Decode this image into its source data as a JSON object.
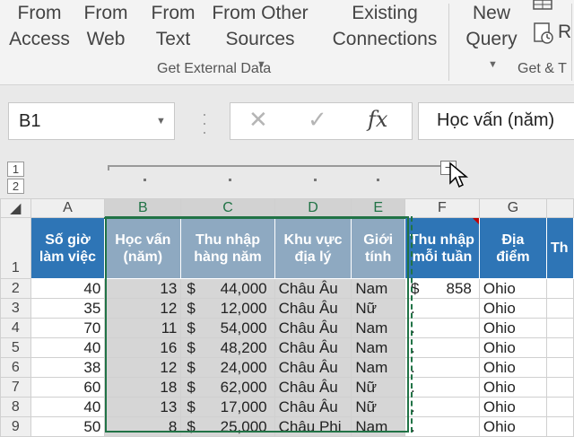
{
  "ribbon": {
    "buttons": [
      {
        "line1": "From",
        "line2": "Access",
        "caret": false
      },
      {
        "line1": "From",
        "line2": "Web",
        "caret": false
      },
      {
        "line1": "From",
        "line2": "Text",
        "caret": false
      },
      {
        "line1": "From Other",
        "line2": "Sources",
        "caret": true
      },
      {
        "line1": "Existing",
        "line2": "Connections",
        "caret": false
      },
      {
        "line1": "New",
        "line2": "Query",
        "caret": true
      }
    ],
    "group_external": "Get External Data",
    "group_transform": "Get & T",
    "side_letter": "R"
  },
  "formula_bar": {
    "name_box": "B1",
    "fx_label": "fx",
    "cancel_glyph": "✕",
    "enter_glyph": "✓",
    "content": "Học vấn (năm)"
  },
  "outline": {
    "levels": [
      "1",
      "2"
    ],
    "collapse_glyph": "−"
  },
  "columns": [
    "A",
    "B",
    "C",
    "D",
    "E",
    "F",
    "G"
  ],
  "header_row": {
    "row_number": "1",
    "cells": [
      "Số giờ làm việc",
      "Học vấn (năm)",
      "Thu nhập hàng năm",
      "Khu vực địa lý",
      "Giới tính",
      "Thu nhập mỗi tuần",
      "Địa điểm",
      "Th"
    ]
  },
  "rows": [
    {
      "n": "2",
      "a": "40",
      "b": "13",
      "c_sym": "$",
      "c_val": "44,000",
      "d": "Châu Âu",
      "e": "Nam",
      "f_sym": "$",
      "f_val": "858",
      "g": "Ohio"
    },
    {
      "n": "3",
      "a": "35",
      "b": "12",
      "c_sym": "$",
      "c_val": "12,000",
      "d": "Châu Âu",
      "e": "Nữ",
      "f_sym": ".",
      "f_val": "",
      "g": "Ohio"
    },
    {
      "n": "4",
      "a": "70",
      "b": "11",
      "c_sym": "$",
      "c_val": "54,000",
      "d": "Châu Âu",
      "e": "Nam",
      "f_sym": ".",
      "f_val": "",
      "g": "Ohio"
    },
    {
      "n": "5",
      "a": "40",
      "b": "16",
      "c_sym": "$",
      "c_val": "48,200",
      "d": "Châu Âu",
      "e": "Nam",
      "f_sym": ".",
      "f_val": "",
      "g": "Ohio"
    },
    {
      "n": "6",
      "a": "38",
      "b": "12",
      "c_sym": "$",
      "c_val": "24,000",
      "d": "Châu Âu",
      "e": "Nam",
      "f_sym": ".",
      "f_val": "",
      "g": "Ohio"
    },
    {
      "n": "7",
      "a": "60",
      "b": "18",
      "c_sym": "$",
      "c_val": "62,000",
      "d": "Châu Âu",
      "e": "Nữ",
      "f_sym": ".",
      "f_val": "",
      "g": "Ohio"
    },
    {
      "n": "8",
      "a": "40",
      "b": "13",
      "c_sym": "$",
      "c_val": "17,000",
      "d": "Châu Âu",
      "e": "Nữ",
      "f_sym": ".",
      "f_val": "",
      "g": "Ohio"
    },
    {
      "n": "9",
      "a": "50",
      "b": "8",
      "c_sym": "$",
      "c_val": "25,000",
      "d": "Châu Phi",
      "e": "Nam",
      "f_sym": ".",
      "f_val": "",
      "g": "Ohio"
    }
  ],
  "colors": {
    "header_blue": "#2e75b6",
    "selection_green": "#217346"
  }
}
